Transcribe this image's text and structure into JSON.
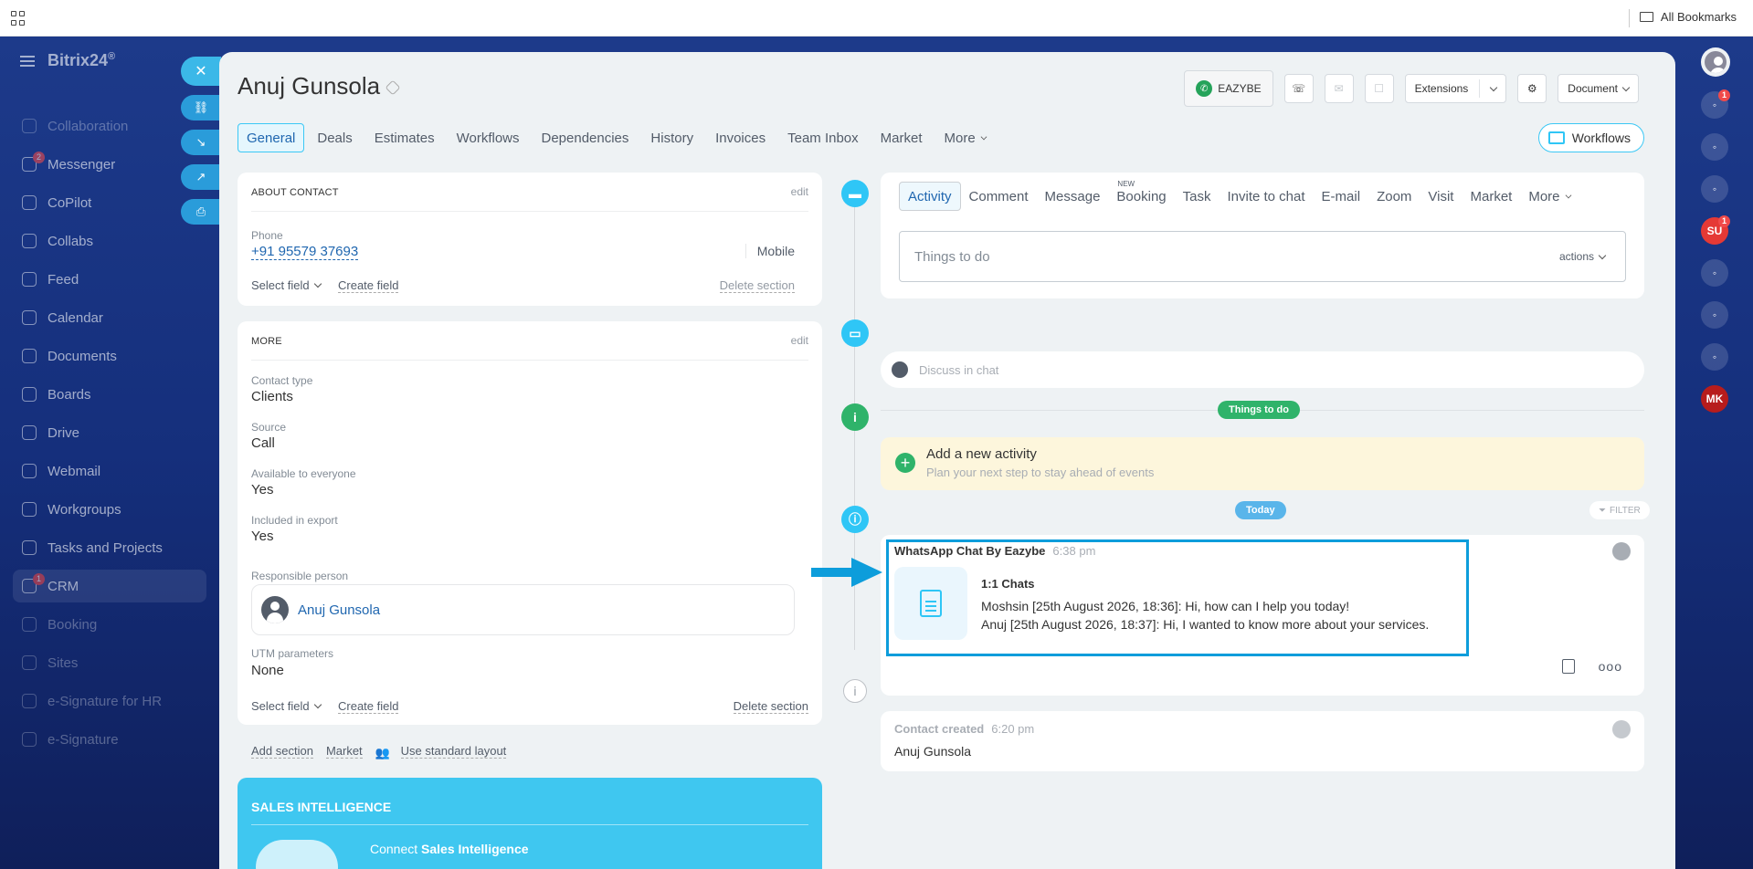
{
  "browser": {
    "bookmarks_label": "All Bookmarks"
  },
  "brand": {
    "name": "Bitrix24",
    "suffix": "®"
  },
  "left_nav": [
    {
      "label": "Collaboration",
      "icon": "collab-icon",
      "dim": true
    },
    {
      "label": "Messenger",
      "icon": "chat-icon",
      "badge": "2"
    },
    {
      "label": "CoPilot",
      "icon": "copilot-icon"
    },
    {
      "label": "Collabs",
      "icon": "collabs-icon"
    },
    {
      "label": "Feed",
      "icon": "feed-icon"
    },
    {
      "label": "Calendar",
      "icon": "calendar-icon"
    },
    {
      "label": "Documents",
      "icon": "document-icon"
    },
    {
      "label": "Boards",
      "icon": "board-icon"
    },
    {
      "label": "Drive",
      "icon": "drive-icon"
    },
    {
      "label": "Webmail",
      "icon": "mail-icon"
    },
    {
      "label": "Workgroups",
      "icon": "group-icon"
    },
    {
      "label": "Tasks and Projects",
      "icon": "task-icon"
    },
    {
      "label": "CRM",
      "icon": "crm-icon",
      "badge": "1",
      "active": true
    },
    {
      "label": "Booking",
      "icon": "booking-icon",
      "dim": true
    },
    {
      "label": "Sites",
      "icon": "sites-icon",
      "dim": true
    },
    {
      "label": "e-Signature for HR",
      "icon": "signature-icon",
      "dim": true
    },
    {
      "label": "e-Signature",
      "icon": "pen-icon",
      "dim": true
    }
  ],
  "contact": {
    "name": "Anuj Gunsola",
    "toolbar": {
      "eazybe": "EAZYBE",
      "extensions": "Extensions",
      "document": "Document"
    },
    "tabs": [
      "General",
      "Deals",
      "Estimates",
      "Workflows",
      "Dependencies",
      "History",
      "Invoices",
      "Team Inbox",
      "Market",
      "More"
    ],
    "workflows_btn": "Workflows"
  },
  "about": {
    "heading": "ABOUT CONTACT",
    "edit": "edit",
    "phone_label": "Phone",
    "phone": "+91 95579 37693",
    "phone_type": "Mobile",
    "select_field": "Select field",
    "create_field": "Create field",
    "delete_section": "Delete section"
  },
  "more": {
    "heading": "MORE",
    "edit": "edit",
    "fields": [
      {
        "label": "Contact type",
        "value": "Clients"
      },
      {
        "label": "Source",
        "value": "Call"
      },
      {
        "label": "Available to everyone",
        "value": "Yes"
      },
      {
        "label": "Included in export",
        "value": "Yes"
      }
    ],
    "responsible_label": "Responsible person",
    "responsible": "Anuj Gunsola",
    "utm_label": "UTM parameters",
    "utm_value": "None",
    "select_field": "Select field",
    "create_field": "Create field",
    "delete_section": "Delete section"
  },
  "bottom_links": {
    "add_section": "Add section",
    "market": "Market",
    "standard": "Use standard layout"
  },
  "sales": {
    "title": "SALES INTELLIGENCE",
    "connect_prefix": "Connect ",
    "connect_bold": "Sales Intelligence"
  },
  "activity": {
    "tabs": [
      "Activity",
      "Comment",
      "Message",
      "Booking",
      "Task",
      "Invite to chat",
      "E-mail",
      "Zoom",
      "Visit",
      "Market",
      "More"
    ],
    "new_tag": "NEW",
    "placeholder": "Things to do",
    "actions": "actions",
    "discuss": "Discuss in chat",
    "things_pill": "Things to do",
    "add_title": "Add a new activity",
    "add_sub": "Plan your next step to stay ahead of events",
    "today_pill": "Today",
    "filter": "FILTER"
  },
  "whatsapp": {
    "title": "WhatsApp Chat By Eazybe",
    "time": "6:38 pm",
    "heading": "1:1 Chats",
    "msg1": "Moshsin [25th August 2026, 18:36]: Hi, how can I help you today!",
    "msg2": "Anuj [25th August 2026, 18:37]: Hi, I wanted to know more about your services."
  },
  "created": {
    "title": "Contact created",
    "time": "6:20 pm",
    "name": "Anuj Gunsola"
  },
  "right_rail": [
    {
      "icon": "bell-icon",
      "badge": "1"
    },
    {
      "icon": "copilot-icon"
    },
    {
      "icon": "chat-search-icon"
    },
    {
      "text": "SU",
      "color": "#e53935",
      "badge": "1"
    },
    {
      "icon": "bookmark-icon"
    },
    {
      "icon": "chat-icon"
    },
    {
      "icon": "table-icon"
    },
    {
      "text": "MK",
      "color": "#b71c1c"
    }
  ]
}
